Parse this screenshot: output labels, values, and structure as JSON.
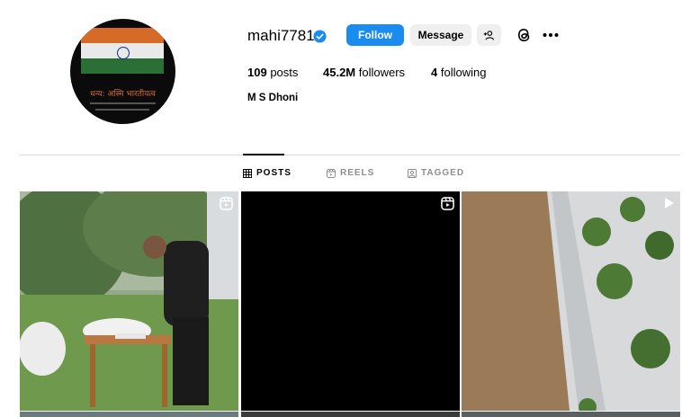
{
  "profile": {
    "username": "mahi7781",
    "full_name": "M S Dhoni",
    "avatar_text": "धन्य: अस्मि भारतीयत्व",
    "stats": {
      "posts_count": "109",
      "posts_label": "posts",
      "followers_count": "45.2M",
      "followers_label": "followers",
      "following_count": "4",
      "following_label": "following"
    }
  },
  "actions": {
    "follow_label": "Follow",
    "message_label": "Message"
  },
  "tabs": [
    {
      "label": "POSTS",
      "icon": "grid-icon",
      "active": true
    },
    {
      "label": "REELS",
      "icon": "reels-icon",
      "active": false
    },
    {
      "label": "TAGGED",
      "icon": "tagged-icon",
      "active": false
    }
  ],
  "colors": {
    "follow_button": "#1a8cf0",
    "verified_badge": "#1a8cf0",
    "secondary_button": "#efefef"
  }
}
